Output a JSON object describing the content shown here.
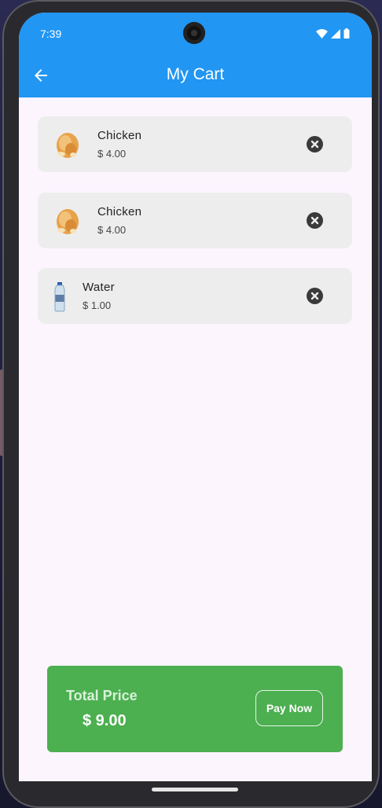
{
  "status_bar": {
    "time": "7:39"
  },
  "app_bar": {
    "title": "My Cart",
    "back_icon": "arrow-left-icon"
  },
  "cart": {
    "items": [
      {
        "name": "Chicken",
        "price": "$ 4.00",
        "thumb": "roast-chicken-image"
      },
      {
        "name": "Chicken",
        "price": "$ 4.00",
        "thumb": "roast-chicken-image"
      },
      {
        "name": "Water",
        "price": "$ 1.00",
        "thumb": "water-bottle-image"
      }
    ]
  },
  "summary": {
    "label": "Total Price",
    "value": "$ 9.00",
    "pay_button": "Pay Now"
  },
  "colors": {
    "app_bar": "#2196f3",
    "total_card": "#4caf50",
    "item_bg": "#ededed"
  }
}
